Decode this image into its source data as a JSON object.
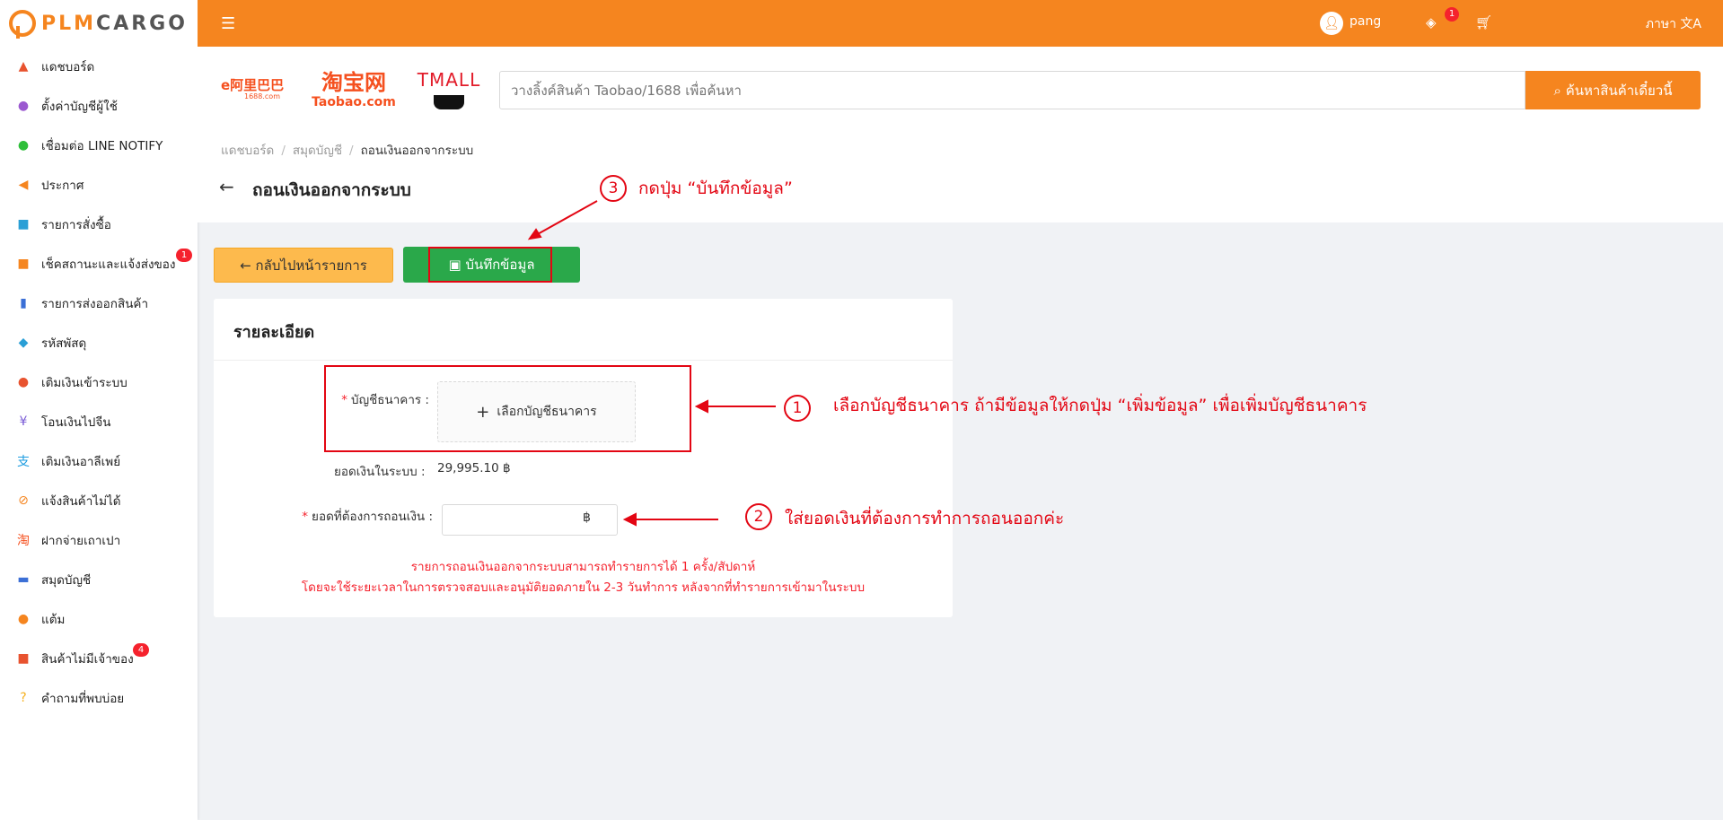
{
  "brand": {
    "logo_text_part1": "PLM",
    "logo_text_part2": "CARGO"
  },
  "sidebar": {
    "items": [
      {
        "label": "แดชบอร์ด",
        "icon": "chart-icon",
        "color": "#e8532f"
      },
      {
        "label": "ตั้งค่าบัญชีผู้ใช้",
        "icon": "user-settings-icon",
        "color": "#9b59d0"
      },
      {
        "label": "เชื่อมต่อ LINE NOTIFY",
        "icon": "line-icon",
        "color": "#2fbf3a"
      },
      {
        "label": "ประกาศ",
        "icon": "megaphone-icon",
        "color": "#f5851f"
      },
      {
        "label": "รายการสั่งซื้อ",
        "icon": "basket-icon",
        "color": "#2a9fd6"
      },
      {
        "label": "เช็คสถานะและแจ้งส่งของ",
        "icon": "truck-icon",
        "color": "#f5851f",
        "badge": "1"
      },
      {
        "label": "รายการส่งออกสินค้า",
        "icon": "dolly-icon",
        "color": "#3b6fd6"
      },
      {
        "label": "รหัสพัสดุ",
        "icon": "box-icon",
        "color": "#2a9fd6"
      },
      {
        "label": "เติมเงินเข้าระบบ",
        "icon": "piggy-bank-icon",
        "color": "#e8532f"
      },
      {
        "label": "โอนเงินไปจีน",
        "icon": "yuan-icon",
        "color": "#7a5cd6"
      },
      {
        "label": "เติมเงินอาลีเพย์",
        "icon": "alipay-icon",
        "color": "#1c9ce0"
      },
      {
        "label": "แจ้งสินค้าไม่ได้",
        "icon": "no-box-icon",
        "color": "#f5851f"
      },
      {
        "label": "ฝากจ่ายเถาเปา",
        "icon": "taobao-icon",
        "color": "#f5501f"
      },
      {
        "label": "สมุดบัญชี",
        "icon": "wallet-icon",
        "color": "#3b6fd6"
      },
      {
        "label": "แต้ม",
        "icon": "medal-icon",
        "color": "#f5851f"
      },
      {
        "label": "สินค้าไม่มีเจ้าของ",
        "icon": "search-box-icon",
        "color": "#e8532f",
        "badge": "4"
      },
      {
        "label": "คำถามที่พบบ่อย",
        "icon": "question-icon",
        "color": "#f5b01f"
      }
    ]
  },
  "header": {
    "menu_icon": "menu-fold-icon",
    "notif_count": "1",
    "user_name": "pang",
    "language_label": "ภาษา"
  },
  "search": {
    "brands": [
      "1688.com",
      "淘宝网",
      "Taobao.com",
      "TMALL"
    ],
    "placeholder": "วางลิ้งค์สินค้า Taobao/1688 เพื่อค้นหา",
    "button_label": "ค้นหาสินค้าเดี๋ยวนี้"
  },
  "breadcrumb": [
    "แดชบอร์ด",
    "สมุดบัญชี",
    "ถอนเงินออกจากระบบ"
  ],
  "page": {
    "title": "ถอนเงินออกจากระบบ"
  },
  "actions": {
    "back_label": "กลับไปหน้ารายการ",
    "save_label": "บันทึกข้อมูล"
  },
  "card": {
    "title": "รายละเอียด",
    "bank_label": "บัญชีธนาคาร :",
    "bank_select_label": "เลือกบัญชีธนาคาร",
    "balance_label": "ยอดเงินในระบบ :",
    "balance_value": "29,995.10 ฿",
    "amount_label": "ยอดที่ต้องการถอนเงิน :",
    "amount_value": "",
    "currency_suffix": "฿",
    "note_line1": "รายการถอนเงินออกจากระบบสามารถทำรายการได้ 1 ครั้ง/สัปดาห์",
    "note_line2": "โดยจะใช้ระยะเวลาในการตรวจสอบและอนุมัติยอดภายใน 2-3 วันทำการ หลังจากที่ทำรายการเข้ามาในระบบ"
  },
  "annotations": {
    "step1_num": "1",
    "step1_text": "เลือกบัญชีธนาคาร ถ้ามีข้อมูลให้กดปุ่ม “เพิ่มข้อมูล” เพื่อเพิ่มบัญชีธนาคาร",
    "step2_num": "2",
    "step2_text": "ใส่ยอดเงินที่ต้องการทำการถอนออกค่ะ",
    "step3_num": "3",
    "step3_text": "กดปุ่ม “บันทึกข้อมูล”",
    "color": "#e30613"
  }
}
